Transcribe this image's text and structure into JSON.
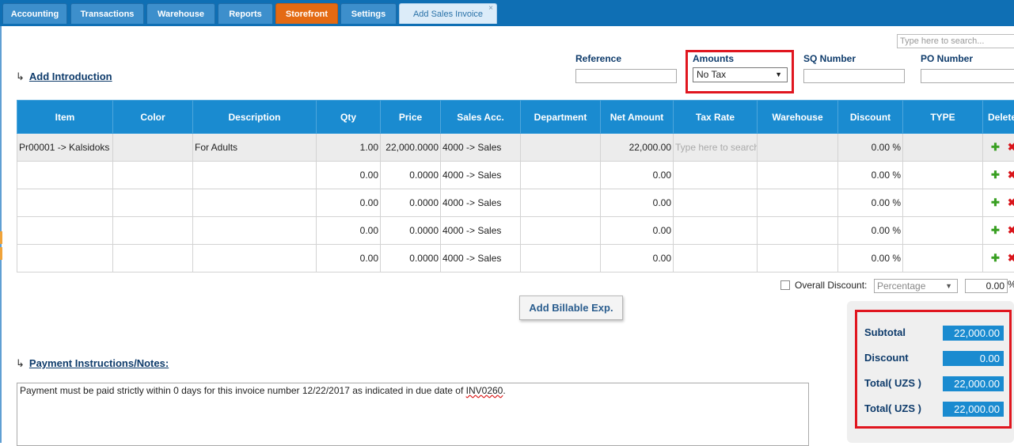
{
  "tabs": [
    {
      "label": "Accounting"
    },
    {
      "label": "Transactions"
    },
    {
      "label": "Warehouse"
    },
    {
      "label": "Reports"
    },
    {
      "label": "Storefront"
    },
    {
      "label": "Settings"
    },
    {
      "label": "Add Sales Invoice",
      "close": "×"
    }
  ],
  "search": {
    "placeholder": "Type here to search..."
  },
  "intro": {
    "arrow": "↳",
    "label": "Add Introduction"
  },
  "fields": {
    "reference": "Reference",
    "amounts": "Amounts",
    "amounts_value": "No Tax",
    "sq_number": "SQ Number",
    "po_number": "PO Number"
  },
  "grid": {
    "headers": [
      "Item",
      "Color",
      "Description",
      "Qty",
      "Price",
      "Sales Acc.",
      "Department",
      "Net Amount",
      "Tax Rate",
      "Warehouse",
      "Discount",
      "TYPE",
      "Delete"
    ],
    "tax_placeholder": "Type here to search",
    "rows": [
      {
        "item": "Pr00001 -> Kalsidoks",
        "color": "",
        "description": "For Adults",
        "qty": "1.00",
        "price": "22,000.0000",
        "sales_acc": "4000 -> Sales",
        "department": "",
        "net": "22,000.00",
        "warehouse": "",
        "discount": "0.00 %",
        "type": ""
      },
      {
        "item": "",
        "color": "",
        "description": "",
        "qty": "0.00",
        "price": "0.0000",
        "sales_acc": "4000 -> Sales",
        "department": "",
        "net": "0.00",
        "warehouse": "",
        "discount": "0.00 %",
        "type": ""
      },
      {
        "item": "",
        "color": "",
        "description": "",
        "qty": "0.00",
        "price": "0.0000",
        "sales_acc": "4000 -> Sales",
        "department": "",
        "net": "0.00",
        "warehouse": "",
        "discount": "0.00 %",
        "type": ""
      },
      {
        "item": "",
        "color": "",
        "description": "",
        "qty": "0.00",
        "price": "0.0000",
        "sales_acc": "4000 -> Sales",
        "department": "",
        "net": "0.00",
        "warehouse": "",
        "discount": "0.00 %",
        "type": ""
      },
      {
        "item": "",
        "color": "",
        "description": "",
        "qty": "0.00",
        "price": "0.0000",
        "sales_acc": "4000 -> Sales",
        "department": "",
        "net": "0.00",
        "warehouse": "",
        "discount": "0.00 %",
        "type": ""
      }
    ],
    "add_icon": "✚",
    "delete_icon": "✖"
  },
  "overall_discount": {
    "label": "Overall Discount:",
    "type": "Percentage",
    "value": "0.00",
    "unit": "%"
  },
  "billable": {
    "label": "Add Billable Exp."
  },
  "totals": {
    "subtotal_label": "Subtotal",
    "subtotal": "22,000.00",
    "discount_label": "Discount",
    "discount": "0.00",
    "total1_label": "Total( UZS )",
    "total1": "22,000.00",
    "total2_label": "Total( UZS )",
    "total2": "22,000.00"
  },
  "payment": {
    "arrow": "↳",
    "label": "Payment Instructions/Notes:",
    "notes_text": "Payment must be paid strictly within 0 days for this invoice number 12/22/2017 as indicated in due date of ",
    "notes_inv": "INV0260",
    "notes_end": "."
  },
  "colors": {
    "tab_bar": "#0f6fb4",
    "header_blue": "#1a8bd0",
    "storefront": "#e46a13",
    "highlight_red": "#e0161f"
  }
}
